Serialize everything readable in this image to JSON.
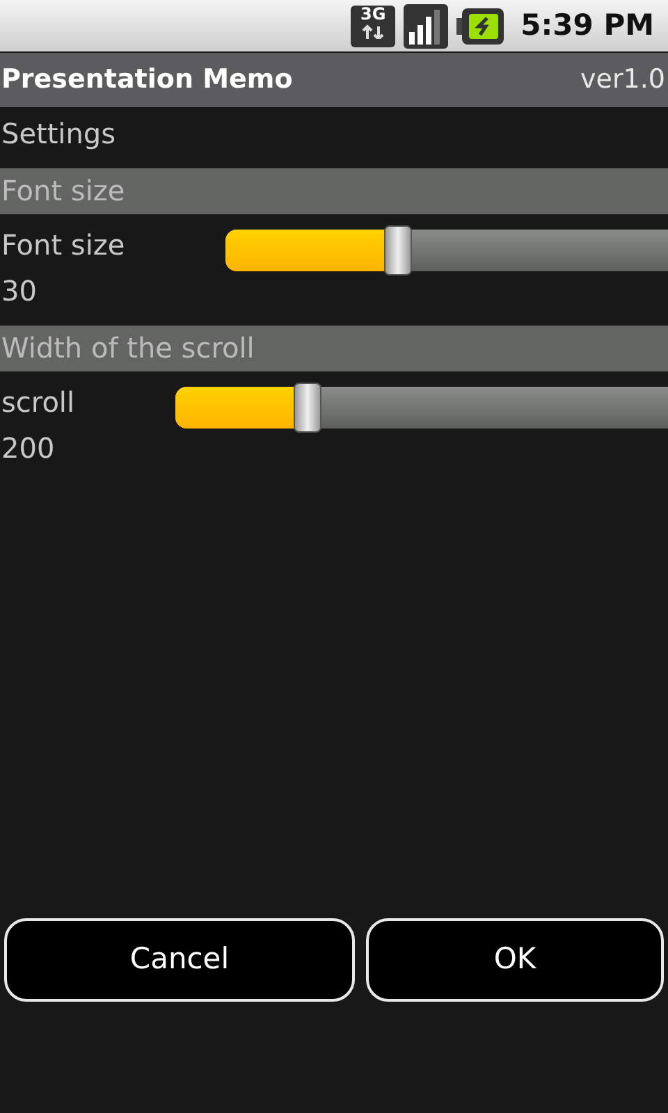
{
  "status_bar": {
    "network": "3G",
    "time": "5:39 PM"
  },
  "title_bar": {
    "title": "Presentation Memo",
    "version": "ver1.0"
  },
  "heading": "Settings",
  "sections": [
    {
      "header": "Font size",
      "label": "Font size",
      "value": "30",
      "level": 0.39
    },
    {
      "header": "Width of the scroll",
      "label": "scroll",
      "value": "200",
      "level": 0.27
    }
  ],
  "buttons": [
    "Cancel",
    "OK"
  ]
}
